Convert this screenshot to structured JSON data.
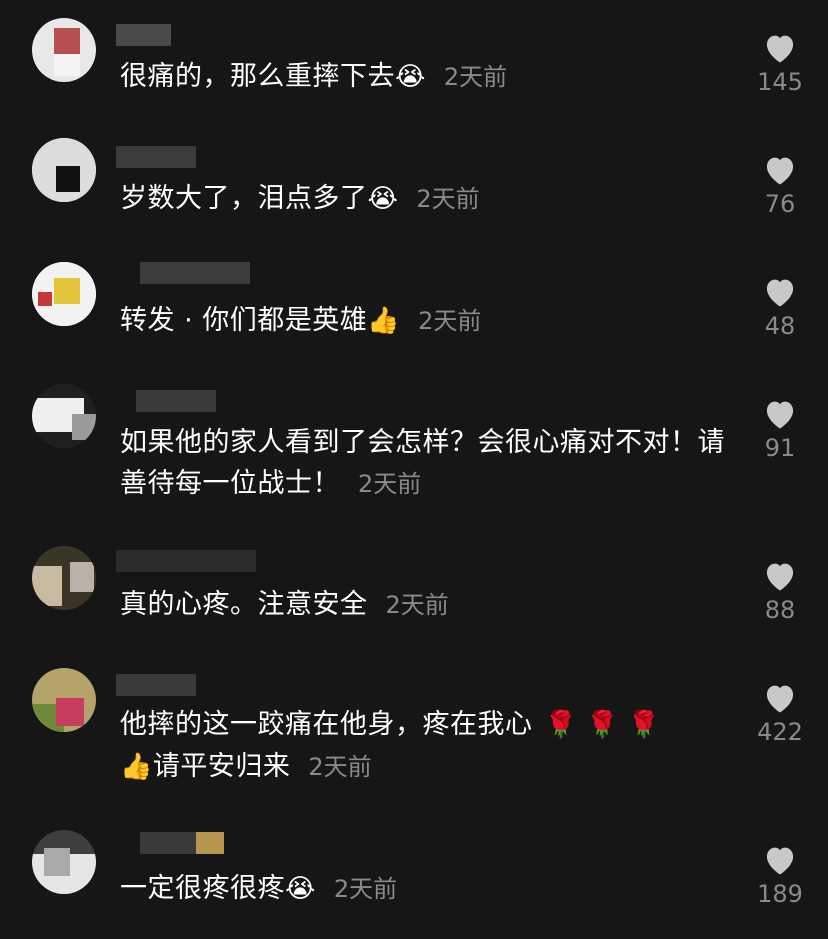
{
  "comments": [
    {
      "text": "很痛的，那么重摔下去",
      "emoji": "😭",
      "time": "2天前",
      "likes": "145"
    },
    {
      "text": "岁数大了，泪点多了",
      "emoji": "😭",
      "time": "2天前",
      "likes": "76"
    },
    {
      "text": "转发 · 你们都是英雄",
      "emoji": "👍",
      "time": "2天前",
      "likes": "48"
    },
    {
      "text": "如果他的家人看到了会怎样？会很心痛对不对！请善待每一位战士！",
      "emoji": "",
      "time": "2天前",
      "likes": "91"
    },
    {
      "text": "真的心疼。注意安全",
      "emoji": "",
      "time": "2天前",
      "likes": "88"
    },
    {
      "text": "他摔的这一跤痛在他身，疼在我心",
      "emoji": "🌹 🌹 🌹",
      "emoji2": "👍",
      "text2": "请平安归来",
      "time": "2天前",
      "likes": "422"
    },
    {
      "text": "一定很疼很疼",
      "emoji": "😭",
      "time": "2天前",
      "likes": "189"
    }
  ],
  "colors": {
    "background": "#161616",
    "text": "#ffffff",
    "muted": "#8a8a8a",
    "heart": "#c8c8c8"
  },
  "icons": {
    "like": "heart-icon"
  }
}
